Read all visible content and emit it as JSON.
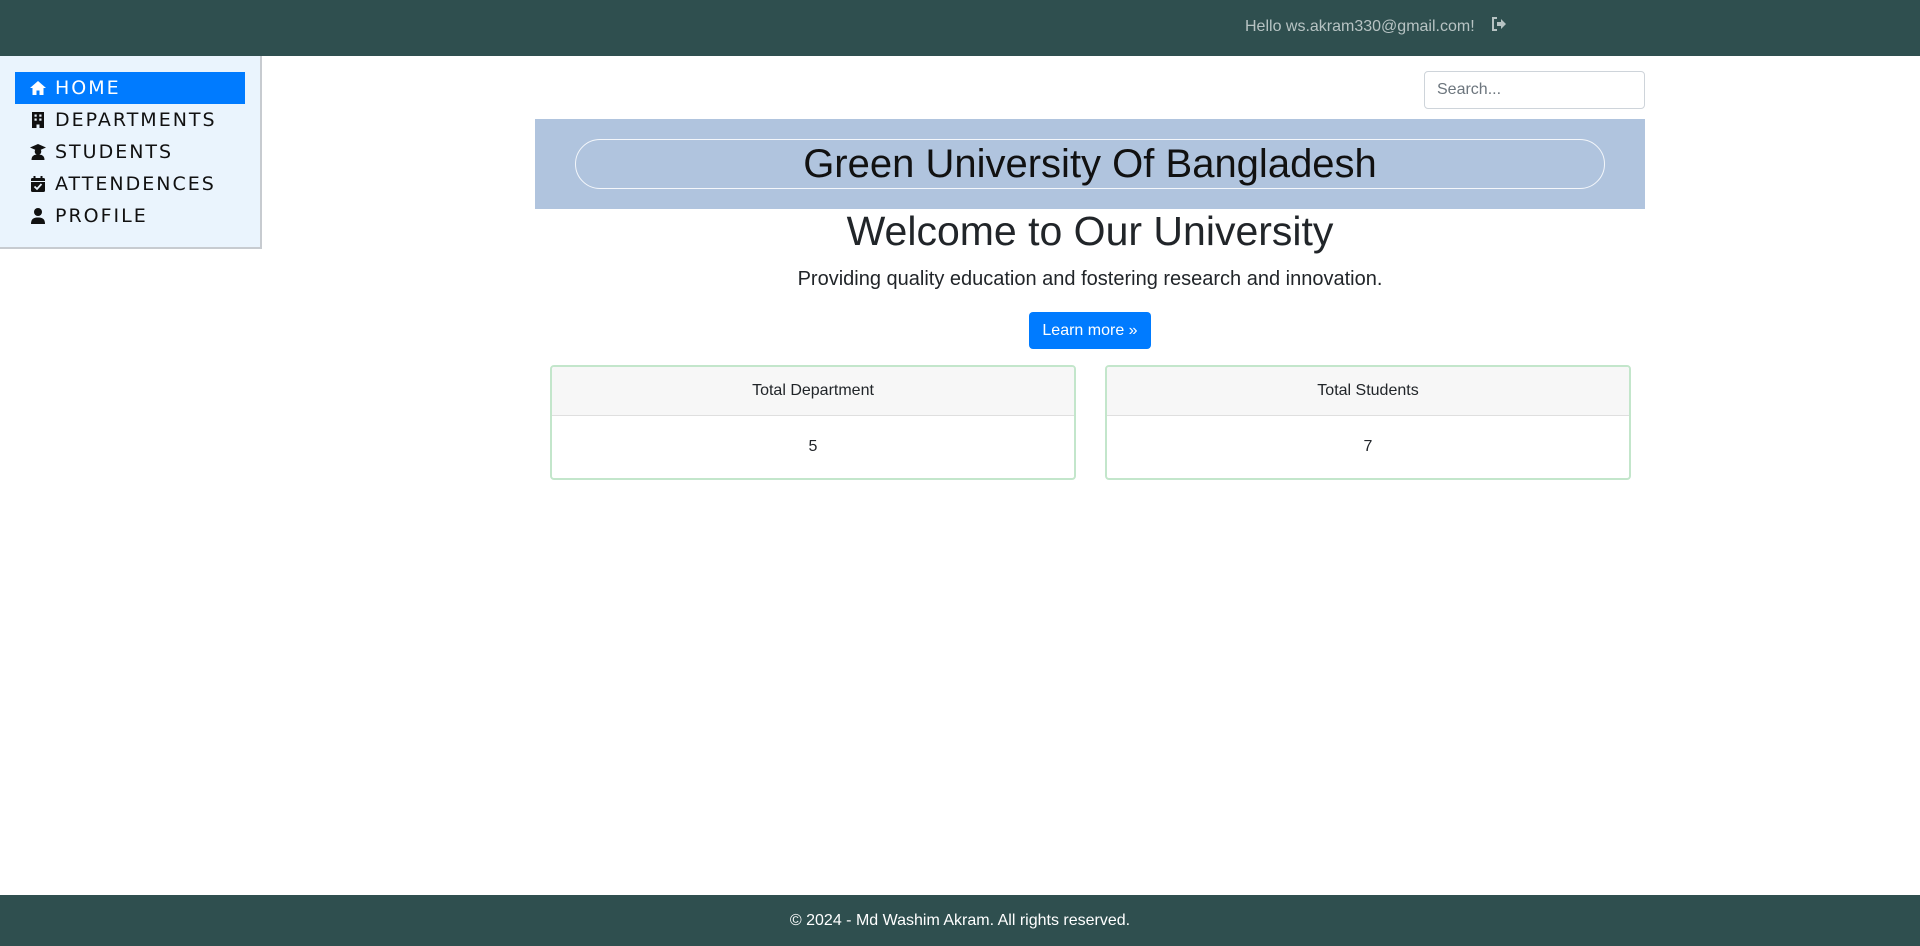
{
  "header": {
    "greeting": "Hello ws.akram330@gmail.com!",
    "logout_icon": "sign-out-icon"
  },
  "sidebar": {
    "items": [
      {
        "label": "HOME",
        "icon": "home-icon",
        "active": true
      },
      {
        "label": "DEPARTMENTS",
        "icon": "building-icon",
        "active": false
      },
      {
        "label": "STUDENTS",
        "icon": "student-icon",
        "active": false
      },
      {
        "label": "ATTENDENCES",
        "icon": "calendar-check-icon",
        "active": false
      },
      {
        "label": "PROFILE",
        "icon": "user-icon",
        "active": false
      }
    ]
  },
  "search": {
    "placeholder": "Search...",
    "value": ""
  },
  "banner": {
    "title": "Green University Of Bangladesh"
  },
  "main": {
    "welcome": "Welcome to Our University",
    "tagline": "Providing quality education and fostering research and innovation.",
    "learn_more": "Learn more »"
  },
  "cards": [
    {
      "header": "Total Department",
      "value": "5"
    },
    {
      "header": "Total Students",
      "value": "7"
    }
  ],
  "footer": {
    "text": "© 2024 - Md Washim Akram. All rights reserved."
  },
  "colors": {
    "navbar": "#2f4f4f",
    "accent": "#007bff",
    "banner": "#b0c4de",
    "sidebar": "#eaf4fd",
    "card_border": "#c3e6cb"
  }
}
